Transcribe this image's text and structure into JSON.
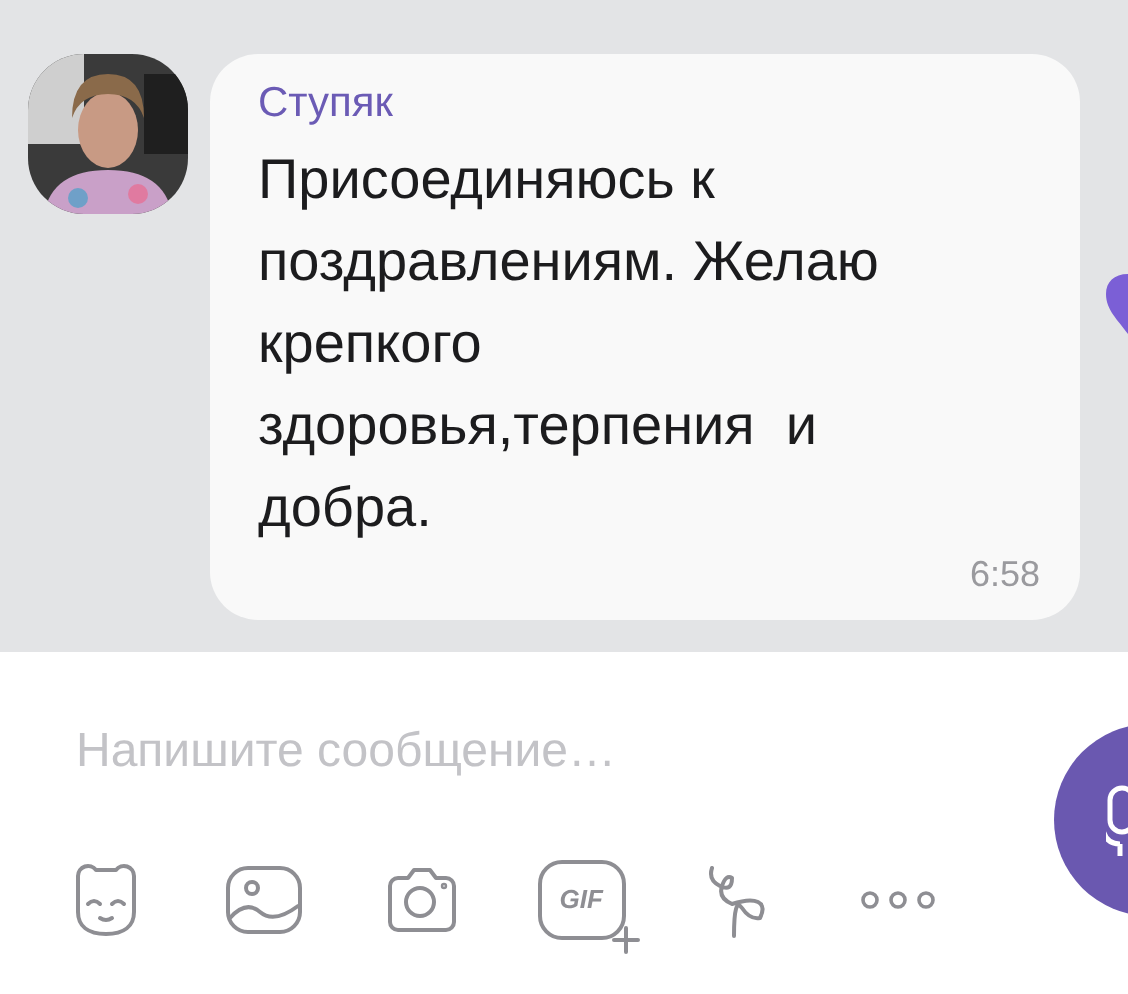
{
  "message": {
    "author": "Ступяк",
    "text": "Присоединяюсь к поздравлениям. Желаю крепкого здоровья,терпения  и добра.",
    "time": "6:58"
  },
  "composer": {
    "placeholder": "Напишите сообщение…"
  },
  "toolbar": [
    {
      "kind": "sticker"
    },
    {
      "kind": "gallery"
    },
    {
      "kind": "camera"
    },
    {
      "kind": "gif",
      "label": "GIF"
    },
    {
      "kind": "doodle"
    },
    {
      "kind": "more"
    }
  ]
}
